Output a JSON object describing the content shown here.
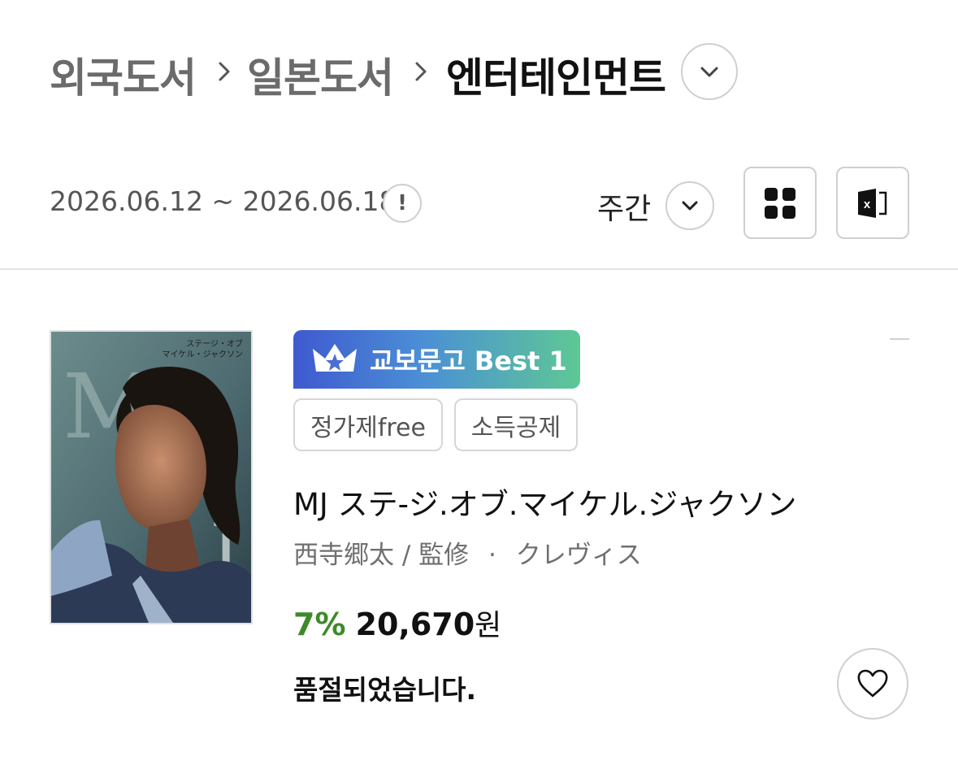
{
  "breadcrumb": {
    "level1": "외국도서",
    "level2": "일본도서",
    "current": "엔터테인먼트"
  },
  "filter": {
    "date_range": "2026.06.12 ~ 2026.06.18",
    "period": "주간"
  },
  "product": {
    "badge": "교보문고 Best 1",
    "tags": [
      "정가제free",
      "소득공제"
    ],
    "title": "MJ ステ-ジ.オブ.マイケル.ジャクソン",
    "author": "西寺郷太 / 監修",
    "separator": "·",
    "publisher": "クレヴィス",
    "discount": "7%",
    "price": "20,670",
    "currency": "원",
    "status": "품절되었습니다.",
    "cover_text": {
      "big": "M",
      "letter": "J",
      "caption_top": "ステージ・オブ",
      "caption_bottom": "マイケル・ジャクソン"
    }
  },
  "icons": {
    "breadcrumb_separator": "chevron-right-icon",
    "category_toggle": "chevron-down-icon",
    "info": "exclamation-icon",
    "period_toggle": "chevron-down-icon",
    "grid_view": "grid-icon",
    "excel": "excel-icon",
    "wishlist": "heart-icon",
    "badge": "crown-icon"
  },
  "colors": {
    "discount": "#3e8a2a",
    "badge_start": "#3f59cf",
    "badge_end": "#5ec894"
  }
}
